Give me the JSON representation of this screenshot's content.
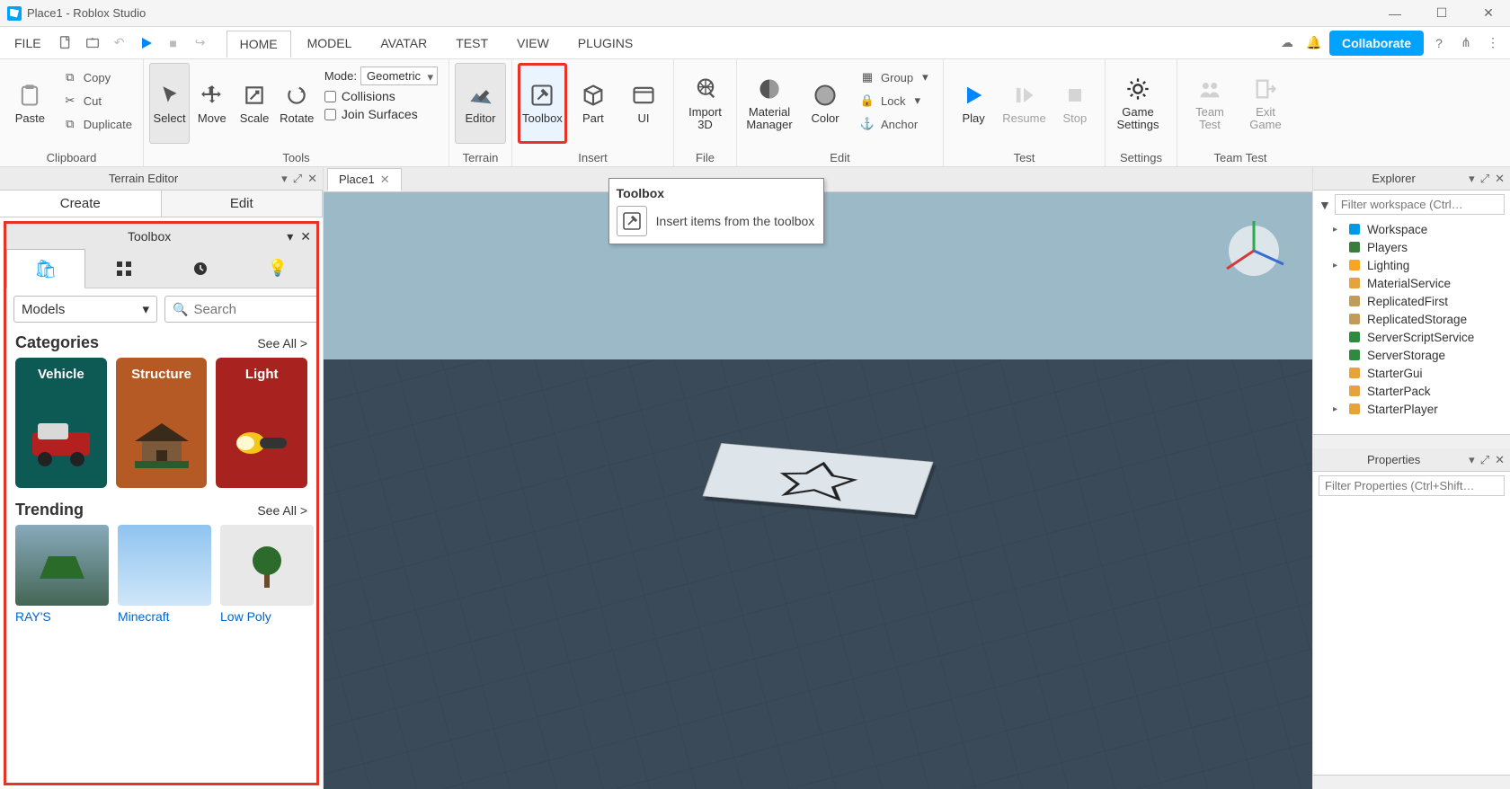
{
  "window": {
    "title": "Place1 - Roblox Studio"
  },
  "winbtns": {
    "min": "—",
    "max": "☐",
    "close": "✕"
  },
  "menu": {
    "file": "FILE"
  },
  "tabs": [
    "HOME",
    "MODEL",
    "AVATAR",
    "TEST",
    "VIEW",
    "PLUGINS"
  ],
  "active_tab": "HOME",
  "collab": "Collaborate",
  "ribbon": {
    "clipboard": {
      "label": "Clipboard",
      "paste": "Paste",
      "copy": "Copy",
      "cut": "Cut",
      "duplicate": "Duplicate"
    },
    "tools": {
      "label": "Tools",
      "select": "Select",
      "move": "Move",
      "scale": "Scale",
      "rotate": "Rotate",
      "mode_label": "Mode:",
      "mode_value": "Geometric",
      "collisions": "Collisions",
      "join": "Join Surfaces"
    },
    "terrain": {
      "label": "Terrain",
      "editor": "Editor"
    },
    "insert": {
      "label": "Insert",
      "toolbox": "Toolbox",
      "part": "Part",
      "ui": "UI"
    },
    "file": {
      "label": "File",
      "import": "Import 3D"
    },
    "edit": {
      "label": "Edit",
      "material": "Material Manager",
      "color": "Color",
      "group": "Group",
      "lock": "Lock",
      "anchor": "Anchor"
    },
    "test": {
      "label": "Test",
      "play": "Play",
      "resume": "Resume",
      "stop": "Stop"
    },
    "settings": {
      "label": "Settings",
      "game": "Game Settings"
    },
    "teamtest": {
      "label": "Team Test",
      "team": "Team Test",
      "exit": "Exit Game"
    }
  },
  "terrain_editor": {
    "title": "Terrain Editor",
    "tabs": {
      "create": "Create",
      "edit": "Edit"
    }
  },
  "toolbox": {
    "title": "Toolbox",
    "select_value": "Models",
    "search_placeholder": "Search",
    "sections": {
      "categories": {
        "title": "Categories",
        "seeall": "See All >",
        "items": [
          {
            "label": "Vehicle",
            "bg": "#0d5a55"
          },
          {
            "label": "Structure",
            "bg": "#b55a24"
          },
          {
            "label": "Light",
            "bg": "#a8231f"
          }
        ]
      },
      "trending": {
        "title": "Trending",
        "seeall": "See All >",
        "items": [
          {
            "label": "RAY'S"
          },
          {
            "label": "Minecraft"
          },
          {
            "label": "Low Poly"
          }
        ]
      }
    }
  },
  "tooltip": {
    "title": "Toolbox",
    "body": "Insert items from the toolbox"
  },
  "doc_tab": "Place1",
  "explorer": {
    "title": "Explorer",
    "filter_placeholder": "Filter workspace (Ctrl…",
    "items": [
      {
        "label": "Workspace",
        "icon": "globe",
        "color": "#0099e5",
        "expandable": true
      },
      {
        "label": "Players",
        "icon": "people",
        "color": "#3a7d3a",
        "expandable": false
      },
      {
        "label": "Lighting",
        "icon": "bulb",
        "color": "#f5a623",
        "expandable": true
      },
      {
        "label": "MaterialService",
        "icon": "mat",
        "color": "#e6a23c",
        "expandable": false
      },
      {
        "label": "ReplicatedFirst",
        "icon": "box",
        "color": "#c29b5a",
        "expandable": false
      },
      {
        "label": "ReplicatedStorage",
        "icon": "box",
        "color": "#c29b5a",
        "expandable": false
      },
      {
        "label": "ServerScriptService",
        "icon": "gear",
        "color": "#2e8b3d",
        "expandable": false
      },
      {
        "label": "ServerStorage",
        "icon": "box",
        "color": "#2e8b3d",
        "expandable": false
      },
      {
        "label": "StarterGui",
        "icon": "folder",
        "color": "#e6a23c",
        "expandable": false
      },
      {
        "label": "StarterPack",
        "icon": "folder",
        "color": "#e6a23c",
        "expandable": false
      },
      {
        "label": "StarterPlayer",
        "icon": "folder",
        "color": "#e6a23c",
        "expandable": true
      }
    ]
  },
  "properties": {
    "title": "Properties",
    "filter_placeholder": "Filter Properties (Ctrl+Shift…"
  }
}
